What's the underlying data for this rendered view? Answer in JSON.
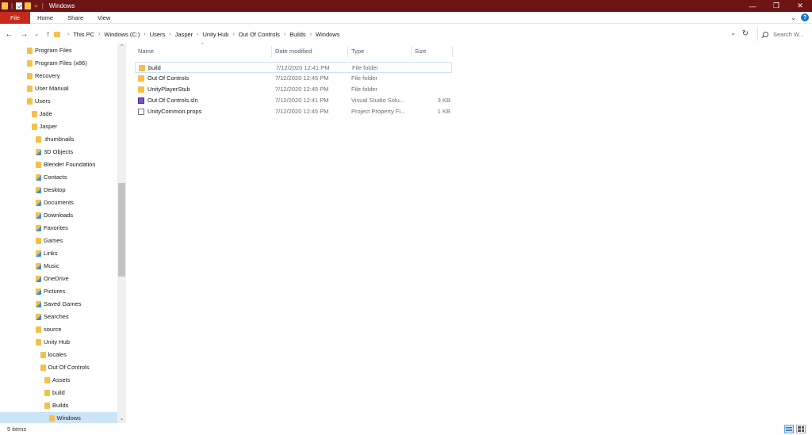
{
  "window": {
    "title": "Windows",
    "controls": {
      "minimize": "—",
      "maximize": "❐",
      "close": "✕"
    }
  },
  "ribbon": {
    "tabs": [
      "File",
      "Home",
      "Share",
      "View"
    ],
    "help": "?"
  },
  "address": {
    "breadcrumbs": [
      "This PC",
      "Windows (C:)",
      "Users",
      "Jasper",
      "Unity Hub",
      "Out Of Controls",
      "Builds",
      "Windows"
    ],
    "search_placeholder": "Search W..."
  },
  "nav_tree": [
    {
      "label": "Program Files",
      "indent": 0,
      "icon": "folder-icon"
    },
    {
      "label": "Program Files (x86)",
      "indent": 0,
      "icon": "folder-icon"
    },
    {
      "label": "Recovery",
      "indent": 0,
      "icon": "folder-icon"
    },
    {
      "label": "User Manual",
      "indent": 0,
      "icon": "folder-icon"
    },
    {
      "label": "Users",
      "indent": 0,
      "icon": "folder-icon"
    },
    {
      "label": "Jade",
      "indent": 1,
      "icon": "folder-icon"
    },
    {
      "label": "Jasper",
      "indent": 1,
      "icon": "folder-icon"
    },
    {
      "label": ".thumbnails",
      "indent": 2,
      "icon": "folder-icon"
    },
    {
      "label": "3D Objects",
      "indent": 2,
      "icon": "3d-objects-icon"
    },
    {
      "label": "Blender Foundation",
      "indent": 2,
      "icon": "folder-icon"
    },
    {
      "label": "Contacts",
      "indent": 2,
      "icon": "contacts-icon"
    },
    {
      "label": "Desktop",
      "indent": 2,
      "icon": "desktop-icon"
    },
    {
      "label": "Documents",
      "indent": 2,
      "icon": "documents-icon"
    },
    {
      "label": "Downloads",
      "indent": 2,
      "icon": "downloads-icon"
    },
    {
      "label": "Favorites",
      "indent": 2,
      "icon": "favorites-icon"
    },
    {
      "label": "Games",
      "indent": 2,
      "icon": "folder-icon"
    },
    {
      "label": "Links",
      "indent": 2,
      "icon": "links-icon"
    },
    {
      "label": "Music",
      "indent": 2,
      "icon": "music-icon"
    },
    {
      "label": "OneDrive",
      "indent": 2,
      "icon": "onedrive-icon"
    },
    {
      "label": "Pictures",
      "indent": 2,
      "icon": "pictures-icon"
    },
    {
      "label": "Saved Games",
      "indent": 2,
      "icon": "saved-games-icon"
    },
    {
      "label": "Searches",
      "indent": 2,
      "icon": "searches-icon"
    },
    {
      "label": "source",
      "indent": 2,
      "icon": "folder-icon"
    },
    {
      "label": "Unity Hub",
      "indent": 2,
      "icon": "folder-icon"
    },
    {
      "label": "locales",
      "indent": 3,
      "icon": "folder-icon"
    },
    {
      "label": "Out Of Controls",
      "indent": 3,
      "icon": "folder-icon"
    },
    {
      "label": "Assets",
      "indent": 4,
      "icon": "folder-icon"
    },
    {
      "label": "build",
      "indent": 4,
      "icon": "folder-icon"
    },
    {
      "label": "Builds",
      "indent": 4,
      "icon": "folder-icon"
    },
    {
      "label": "Windows",
      "indent": 5,
      "icon": "folder-icon",
      "selected": true
    }
  ],
  "columns": {
    "name": "Name",
    "date": "Date modified",
    "type": "Type",
    "size": "Size"
  },
  "files": [
    {
      "name": "build",
      "date": "7/12/2020 12:41 PM",
      "type": "File folder",
      "size": "",
      "icon": "folder-icon"
    },
    {
      "name": "Out Of Controls",
      "date": "7/12/2020 12:45 PM",
      "type": "File folder",
      "size": "",
      "icon": "folder-icon"
    },
    {
      "name": "UnityPlayerStub",
      "date": "7/12/2020 12:45 PM",
      "type": "File folder",
      "size": "",
      "icon": "folder-icon"
    },
    {
      "name": "Out Of Controls.sln",
      "date": "7/12/2020 12:41 PM",
      "type": "Visual Studio Solu...",
      "size": "3 KB",
      "icon": "visual-studio-solution-icon"
    },
    {
      "name": "UnityCommon.props",
      "date": "7/12/2020 12:45 PM",
      "type": "Project Property Fi...",
      "size": "1 KB",
      "icon": "project-property-file-icon"
    }
  ],
  "status": {
    "item_count": "5 items"
  },
  "colors": {
    "titlebar": "#6e1414",
    "file_tab": "#c42b1c",
    "selection": "#cce4f7",
    "folder": "#f5c04a"
  }
}
